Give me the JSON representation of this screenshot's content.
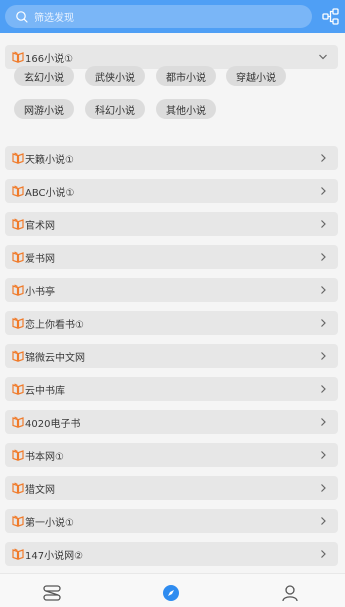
{
  "search": {
    "placeholder": "筛选发现"
  },
  "groups": [
    {
      "label": "166小说①",
      "expanded": true
    },
    {
      "label": "天籁小说①"
    },
    {
      "label": "ABC小说①"
    },
    {
      "label": "官术网"
    },
    {
      "label": "爱书网"
    },
    {
      "label": "小书亭"
    },
    {
      "label": "恋上你看书①"
    },
    {
      "label": "锦微云中文网"
    },
    {
      "label": "云中书库"
    },
    {
      "label": "4020电子书"
    },
    {
      "label": "书本网①"
    },
    {
      "label": "猎文网"
    },
    {
      "label": "第一小说①"
    },
    {
      "label": "147小说网②"
    }
  ],
  "tags": [
    "玄幻小说",
    "武侠小说",
    "都市小说",
    "穿越小说",
    "网游小说",
    "科幻小说",
    "其他小说"
  ],
  "colors": {
    "accent": "#4f9ff5",
    "icon": "#f07b2b",
    "nav_active": "#2f8cf0"
  },
  "nav": {
    "items": [
      "bookshelf-icon",
      "compass-icon",
      "user-icon"
    ],
    "active": 1
  }
}
